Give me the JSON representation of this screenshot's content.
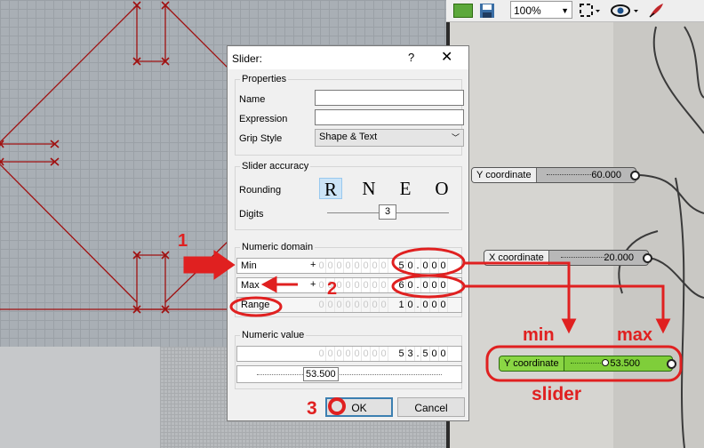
{
  "toolbar": {
    "zoom": "100%",
    "icons": [
      "open-file-icon",
      "save-icon",
      "zoom-fit-icon",
      "eye-icon",
      "brush-icon"
    ]
  },
  "dialog": {
    "title": "Slider:",
    "help": "?",
    "close": "✕",
    "properties": {
      "group_label": "Properties",
      "name_label": "Name",
      "name_value": "",
      "expression_label": "Expression",
      "expression_value": "",
      "grip_style_label": "Grip Style",
      "grip_style_value": "Shape & Text"
    },
    "accuracy": {
      "group_label": "Slider accuracy",
      "rounding_label": "Rounding",
      "rounding_options": [
        "R",
        "N",
        "E",
        "O"
      ],
      "rounding_selected": "R",
      "digits_label": "Digits",
      "digits_value": "3"
    },
    "domain": {
      "group_label": "Numeric domain",
      "min_label": "Min",
      "max_label": "Max",
      "range_label": "Range",
      "sign": "+",
      "min_digits": [
        "5",
        "0",
        "0",
        "0",
        "0"
      ],
      "max_digits": [
        "6",
        "0",
        "0",
        "0",
        "0"
      ],
      "range_digits": [
        "1",
        "0",
        "0",
        "0",
        "0"
      ]
    },
    "value": {
      "group_label": "Numeric value",
      "digits": [
        "5",
        "3",
        "5",
        "0",
        "0"
      ],
      "slider_value": "53.500"
    },
    "ok_label": "OK",
    "cancel_label": "Cancel"
  },
  "canvas": {
    "components": [
      {
        "name": "Y coordinate",
        "value": "60.000"
      },
      {
        "name": "X coordinate",
        "value": "20.000"
      },
      {
        "name": "Y coordinate",
        "value": "53.500"
      }
    ]
  },
  "annotations": {
    "step1": "1",
    "step2": "2",
    "step3": "3",
    "min": "min",
    "max": "max",
    "slider": "slider"
  },
  "colors": {
    "annotation": "#e02020",
    "geometry": "#a01010",
    "slider_green": "#7fce3a"
  }
}
